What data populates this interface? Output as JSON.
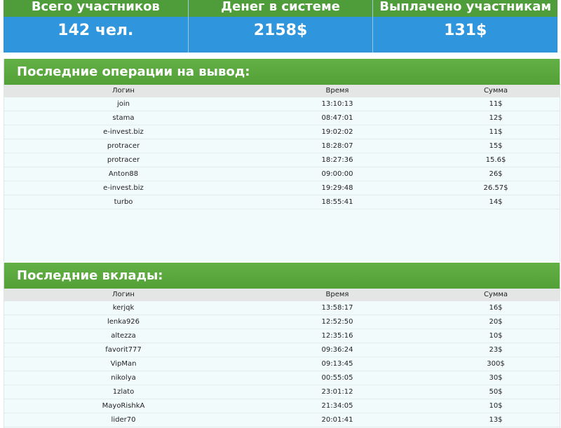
{
  "stats": [
    {
      "label": "Всего участников",
      "value": "142 чел."
    },
    {
      "label": "Денег в системе",
      "value": "2158$"
    },
    {
      "label": "Выплачено участникам",
      "value": "131$"
    }
  ],
  "withdrawals": {
    "title": "Последние операции на вывод:",
    "columns": {
      "login": "Логин",
      "time": "Время",
      "amount": "Сумма"
    },
    "rows": [
      {
        "login": "join",
        "time": "13:10:13",
        "amount": "11$"
      },
      {
        "login": "stama",
        "time": "08:47:01",
        "amount": "12$"
      },
      {
        "login": "e-invest.biz",
        "time": "19:02:02",
        "amount": "11$"
      },
      {
        "login": "protracer",
        "time": "18:28:07",
        "amount": "15$"
      },
      {
        "login": "protracer",
        "time": "18:27:36",
        "amount": "15.6$"
      },
      {
        "login": "Anton88",
        "time": "09:00:00",
        "amount": "26$"
      },
      {
        "login": "e-invest.biz",
        "time": "19:29:48",
        "amount": "26.57$"
      },
      {
        "login": "turbo",
        "time": "18:55:41",
        "amount": "14$"
      }
    ]
  },
  "deposits": {
    "title": "Последние вклады:",
    "columns": {
      "login": "Логин",
      "time": "Время",
      "amount": "Сумма"
    },
    "rows": [
      {
        "login": "kerjqk",
        "time": "13:58:17",
        "amount": "16$"
      },
      {
        "login": "lenka926",
        "time": "12:52:50",
        "amount": "20$"
      },
      {
        "login": "altezza",
        "time": "12:35:16",
        "amount": "10$"
      },
      {
        "login": "favorit777",
        "time": "09:36:24",
        "amount": "23$"
      },
      {
        "login": "VipMan",
        "time": "09:13:45",
        "amount": "300$"
      },
      {
        "login": "nikolya",
        "time": "00:55:05",
        "amount": "30$"
      },
      {
        "login": "1zlato",
        "time": "23:01:12",
        "amount": "50$"
      },
      {
        "login": "MayoRishkA",
        "time": "21:34:05",
        "amount": "10$"
      },
      {
        "login": "lider70",
        "time": "20:01:41",
        "amount": "13$"
      }
    ]
  }
}
